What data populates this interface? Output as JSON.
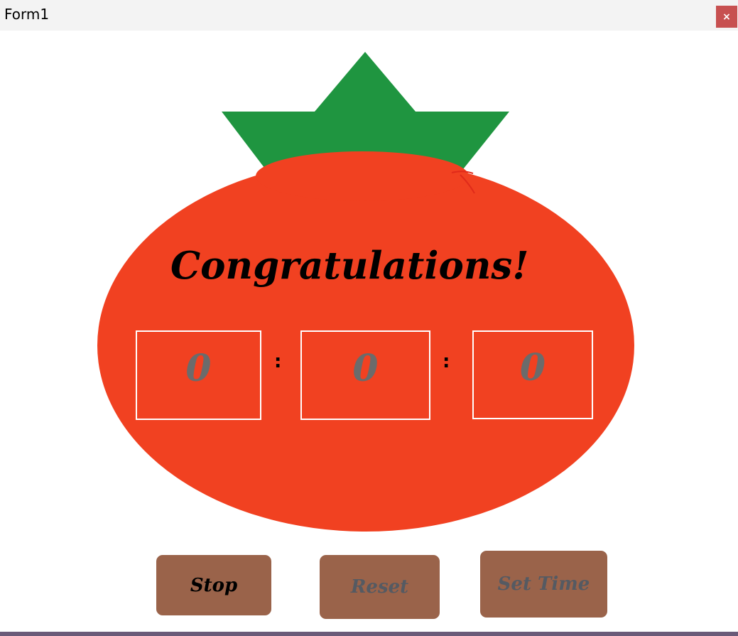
{
  "window": {
    "title": "Form1",
    "close_label": "×"
  },
  "tomato": {
    "body_color": "#f14121",
    "leaf_color": "#1f9540"
  },
  "message": "Congratulations!",
  "timer": {
    "hours": "0",
    "separator_1": ":",
    "minutes": "0",
    "separator_2": ":",
    "seconds": "0"
  },
  "buttons": {
    "stop": {
      "label": "Stop",
      "enabled": true
    },
    "reset": {
      "label": "Reset",
      "enabled": false
    },
    "set_time": {
      "label": "Set Time",
      "enabled": false
    }
  },
  "colors": {
    "button_bg": "#9a634a",
    "close_bg": "#c75050",
    "timer_digits": "#6b6b6b"
  }
}
